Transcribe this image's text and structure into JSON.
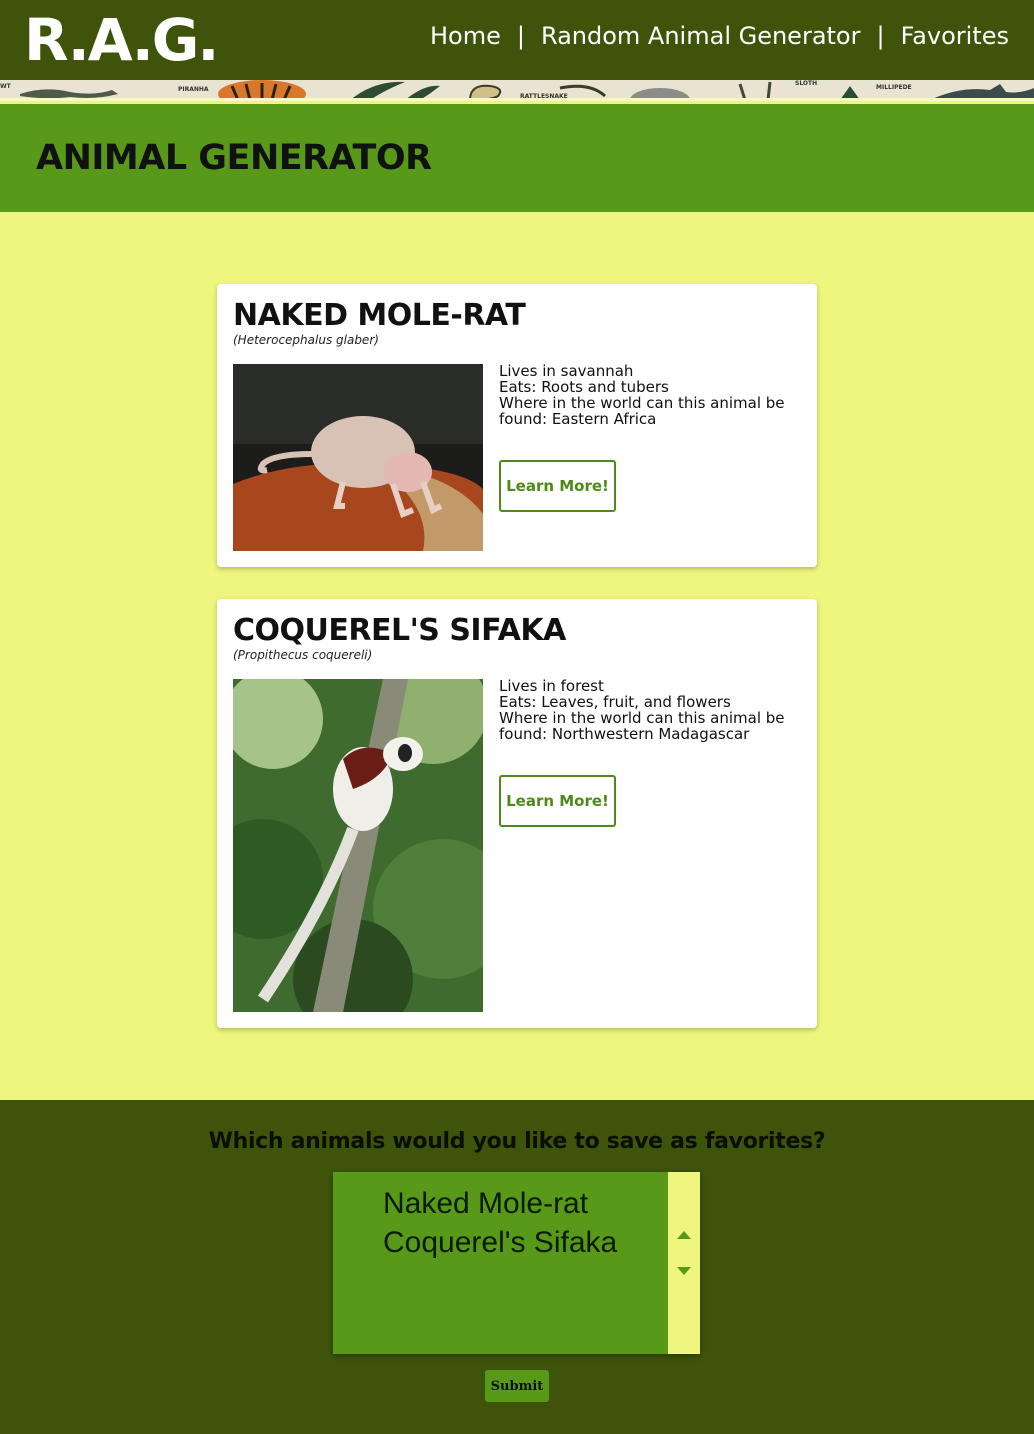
{
  "header": {
    "logo": "R.A.G.",
    "nav": [
      {
        "label": "Home"
      },
      {
        "label": "Random Animal Generator"
      },
      {
        "label": "Favorites"
      }
    ],
    "separator": "|"
  },
  "banner": {
    "labels": [
      "WT",
      "PIRANHA",
      "RATTLESNAKE",
      "SLOTH",
      "MILLIPEDE"
    ]
  },
  "page": {
    "title": "ANIMAL GENERATOR"
  },
  "animals": [
    {
      "name": "NAKED MOLE-RAT",
      "scientific": "(Heterocephalus glaber)",
      "habitat": "Lives in savannah",
      "diet": "Eats: Roots and tubers",
      "location": "Where in the world can this animal be found: Eastern Africa",
      "button": "Learn More!"
    },
    {
      "name": "COQUEREL'S SIFAKA",
      "scientific": "(Propithecus coquereli)",
      "habitat": "Lives in forest",
      "diet": "Eats: Leaves, fruit, and flowers",
      "location": "Where in the world can this animal be found: Northwestern Madagascar",
      "button": "Learn More!"
    }
  ],
  "favorites": {
    "question": "Which animals would you like to save as favorites?",
    "options": [
      "Naked Mole-rat",
      "Coquerel's Sifaka"
    ],
    "submit": "Submit"
  },
  "colors": {
    "dark_green": "#3e540b",
    "green": "#58991a",
    "light_yellow": "#eef67e"
  }
}
